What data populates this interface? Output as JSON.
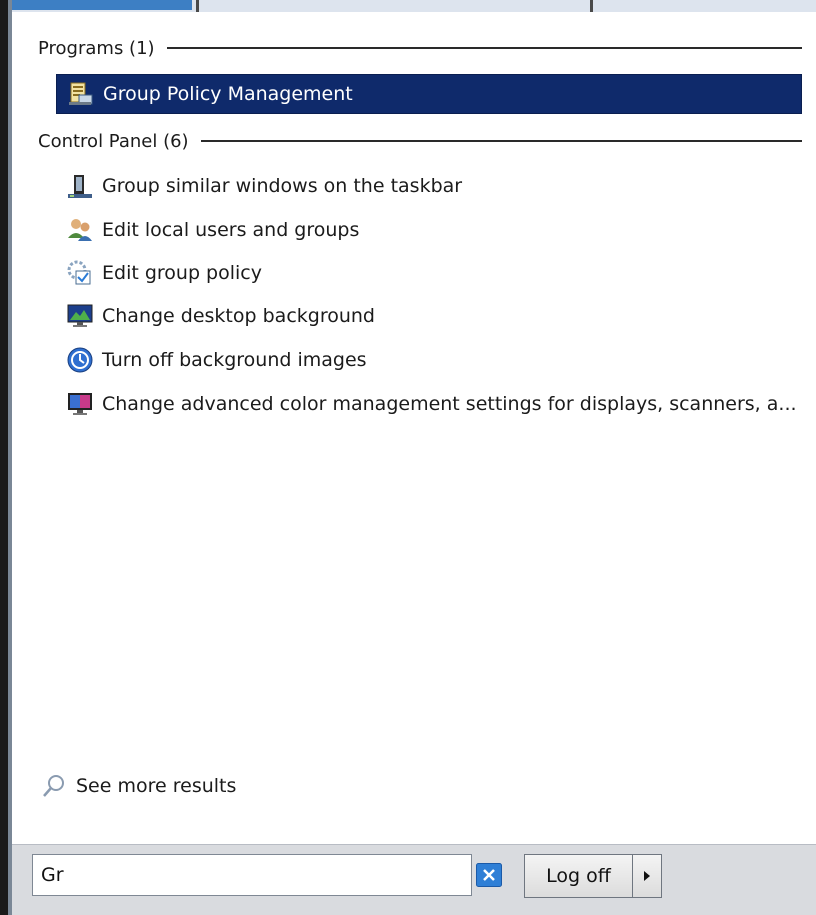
{
  "groups": [
    {
      "label": "Programs (1)",
      "items": [
        {
          "label": "Group Policy Management",
          "icon": "group-policy-management-icon",
          "selected": true
        }
      ]
    },
    {
      "label": "Control Panel (6)",
      "items": [
        {
          "label": "Group similar windows on the taskbar",
          "icon": "taskbar-icon"
        },
        {
          "label": "Edit local users and groups",
          "icon": "users-icon"
        },
        {
          "label": "Edit group policy",
          "icon": "group-policy-icon"
        },
        {
          "label": "Change desktop background",
          "icon": "desktop-background-icon"
        },
        {
          "label": "Turn off background images",
          "icon": "ease-of-access-icon"
        },
        {
          "label": "Change advanced color management settings for displays, scanners, a...",
          "icon": "color-management-icon"
        }
      ]
    }
  ],
  "see_more": {
    "label": "See more results",
    "icon": "search-icon"
  },
  "search": {
    "value": "Gr"
  },
  "logoff": {
    "label": "Log off"
  },
  "colors": {
    "selection": "#0f2a6b",
    "bottom_bar": "#d9dbdf",
    "clear_button": "#2f7fd6"
  }
}
